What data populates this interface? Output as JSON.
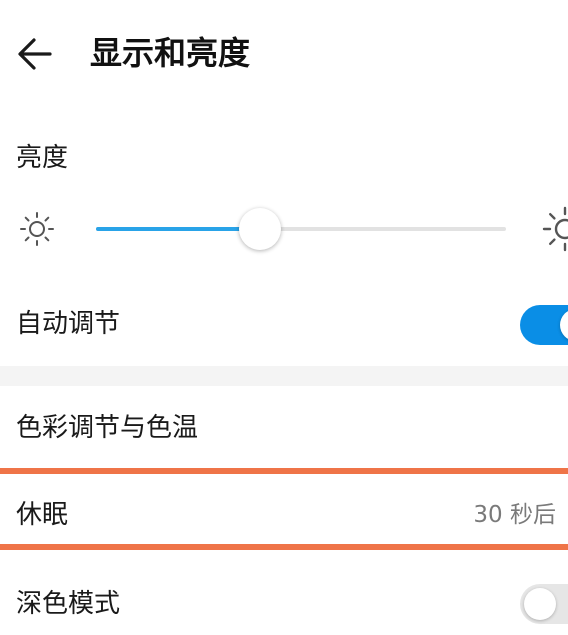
{
  "header": {
    "title": "显示和亮度",
    "back_icon": "arrow-left-icon"
  },
  "brightness": {
    "label": "亮度",
    "level_fraction": 0.4,
    "low_icon": "sun-small-icon",
    "high_icon": "sun-large-icon",
    "accent_color": "#29a3e8"
  },
  "auto_adjust": {
    "label": "自动调节",
    "enabled": true
  },
  "color_temp": {
    "label": "色彩调节与色温"
  },
  "sleep": {
    "label": "休眠",
    "value": "30 秒后"
  },
  "dark_mode": {
    "label": "深色模式",
    "enabled": false
  },
  "colors": {
    "toggle_on": "#0a8ee6",
    "highlight": "#ef7448"
  }
}
